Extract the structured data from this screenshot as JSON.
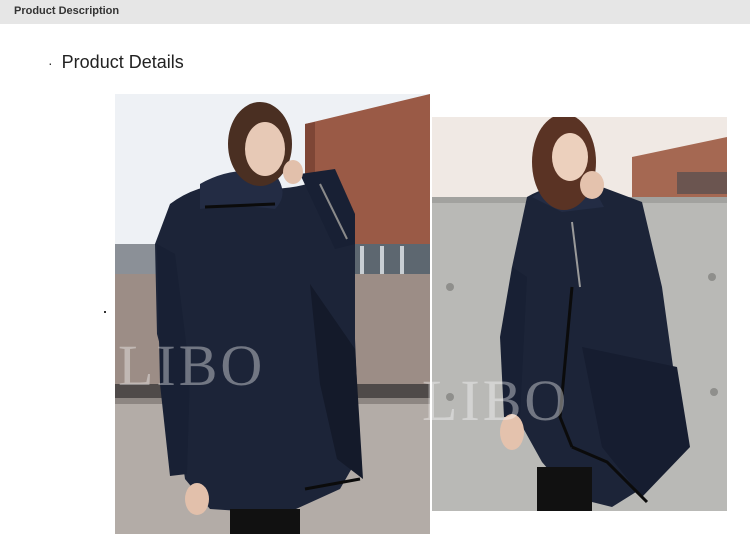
{
  "header": {
    "title": "Product Description"
  },
  "section": {
    "bullet": "·",
    "title": "Product Details"
  },
  "images": [
    {
      "name": "model-photo-left",
      "subject": "woman in navy asymmetric zip coat, outdoor urban scene"
    },
    {
      "name": "model-photo-right",
      "subject": "woman in navy asymmetric zip coat against concrete wall"
    }
  ],
  "watermark": {
    "text": "LIBO"
  },
  "colors": {
    "header_bg": "#e6e6e6",
    "coat_navy": "#1c2438",
    "sky": "#eef1f5",
    "brick": "#9a5a46",
    "concrete": "#b9b9b6"
  }
}
